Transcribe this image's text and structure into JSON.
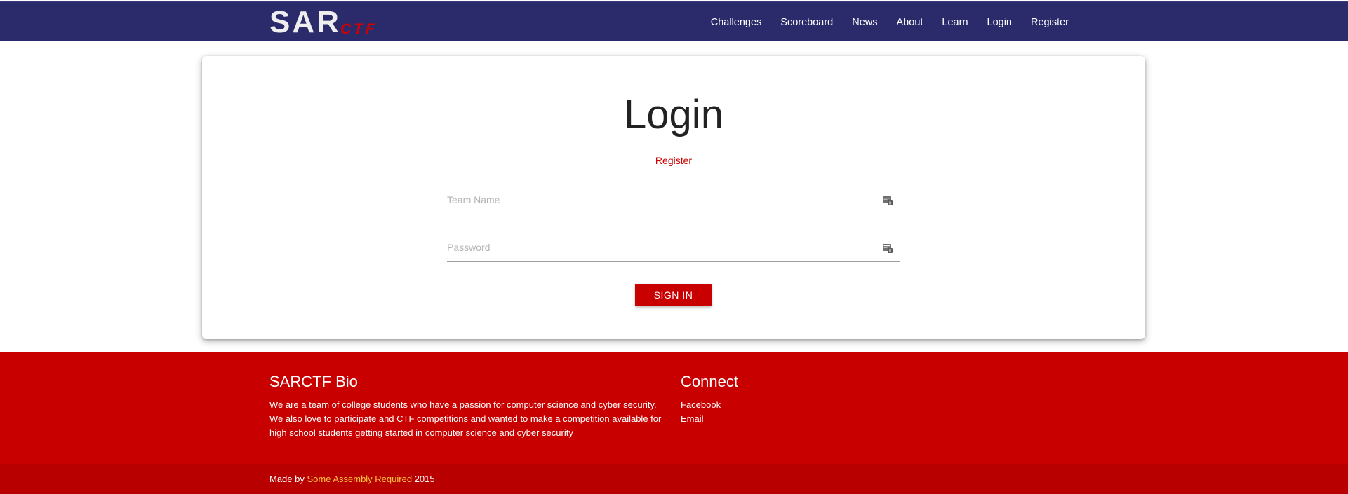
{
  "brand": {
    "sar": "SAR",
    "ctf": "CTF"
  },
  "nav": {
    "items": [
      {
        "label": "Challenges"
      },
      {
        "label": "Scoreboard"
      },
      {
        "label": "News"
      },
      {
        "label": "About"
      },
      {
        "label": "Learn"
      },
      {
        "label": "Login"
      },
      {
        "label": "Register"
      }
    ]
  },
  "login": {
    "title": "Login",
    "register_link": "Register",
    "team_name_placeholder": "Team Name",
    "password_placeholder": "Password",
    "sign_in_label": "SIGN IN"
  },
  "footer": {
    "bio_title": "SARCTF Bio",
    "bio_text": "We are a team of college students who have a passion for computer science and cyber security. We also love to participate and CTF competitions and wanted to make a competition available for high school students getting started in computer science and cyber security",
    "connect_title": "Connect",
    "connect_links": [
      {
        "label": "Facebook"
      },
      {
        "label": "Email"
      }
    ],
    "made_prefix": "Made by ",
    "made_link": "Some Assembly Required",
    "made_year": " 2015"
  },
  "colors": {
    "nav_bg": "#2b2b6b",
    "accent_red": "#c80000",
    "footer_bottom": "#b80000",
    "made_link": "#ffc83c"
  },
  "icons": [
    "key-card-icon",
    "key-card-icon"
  ]
}
